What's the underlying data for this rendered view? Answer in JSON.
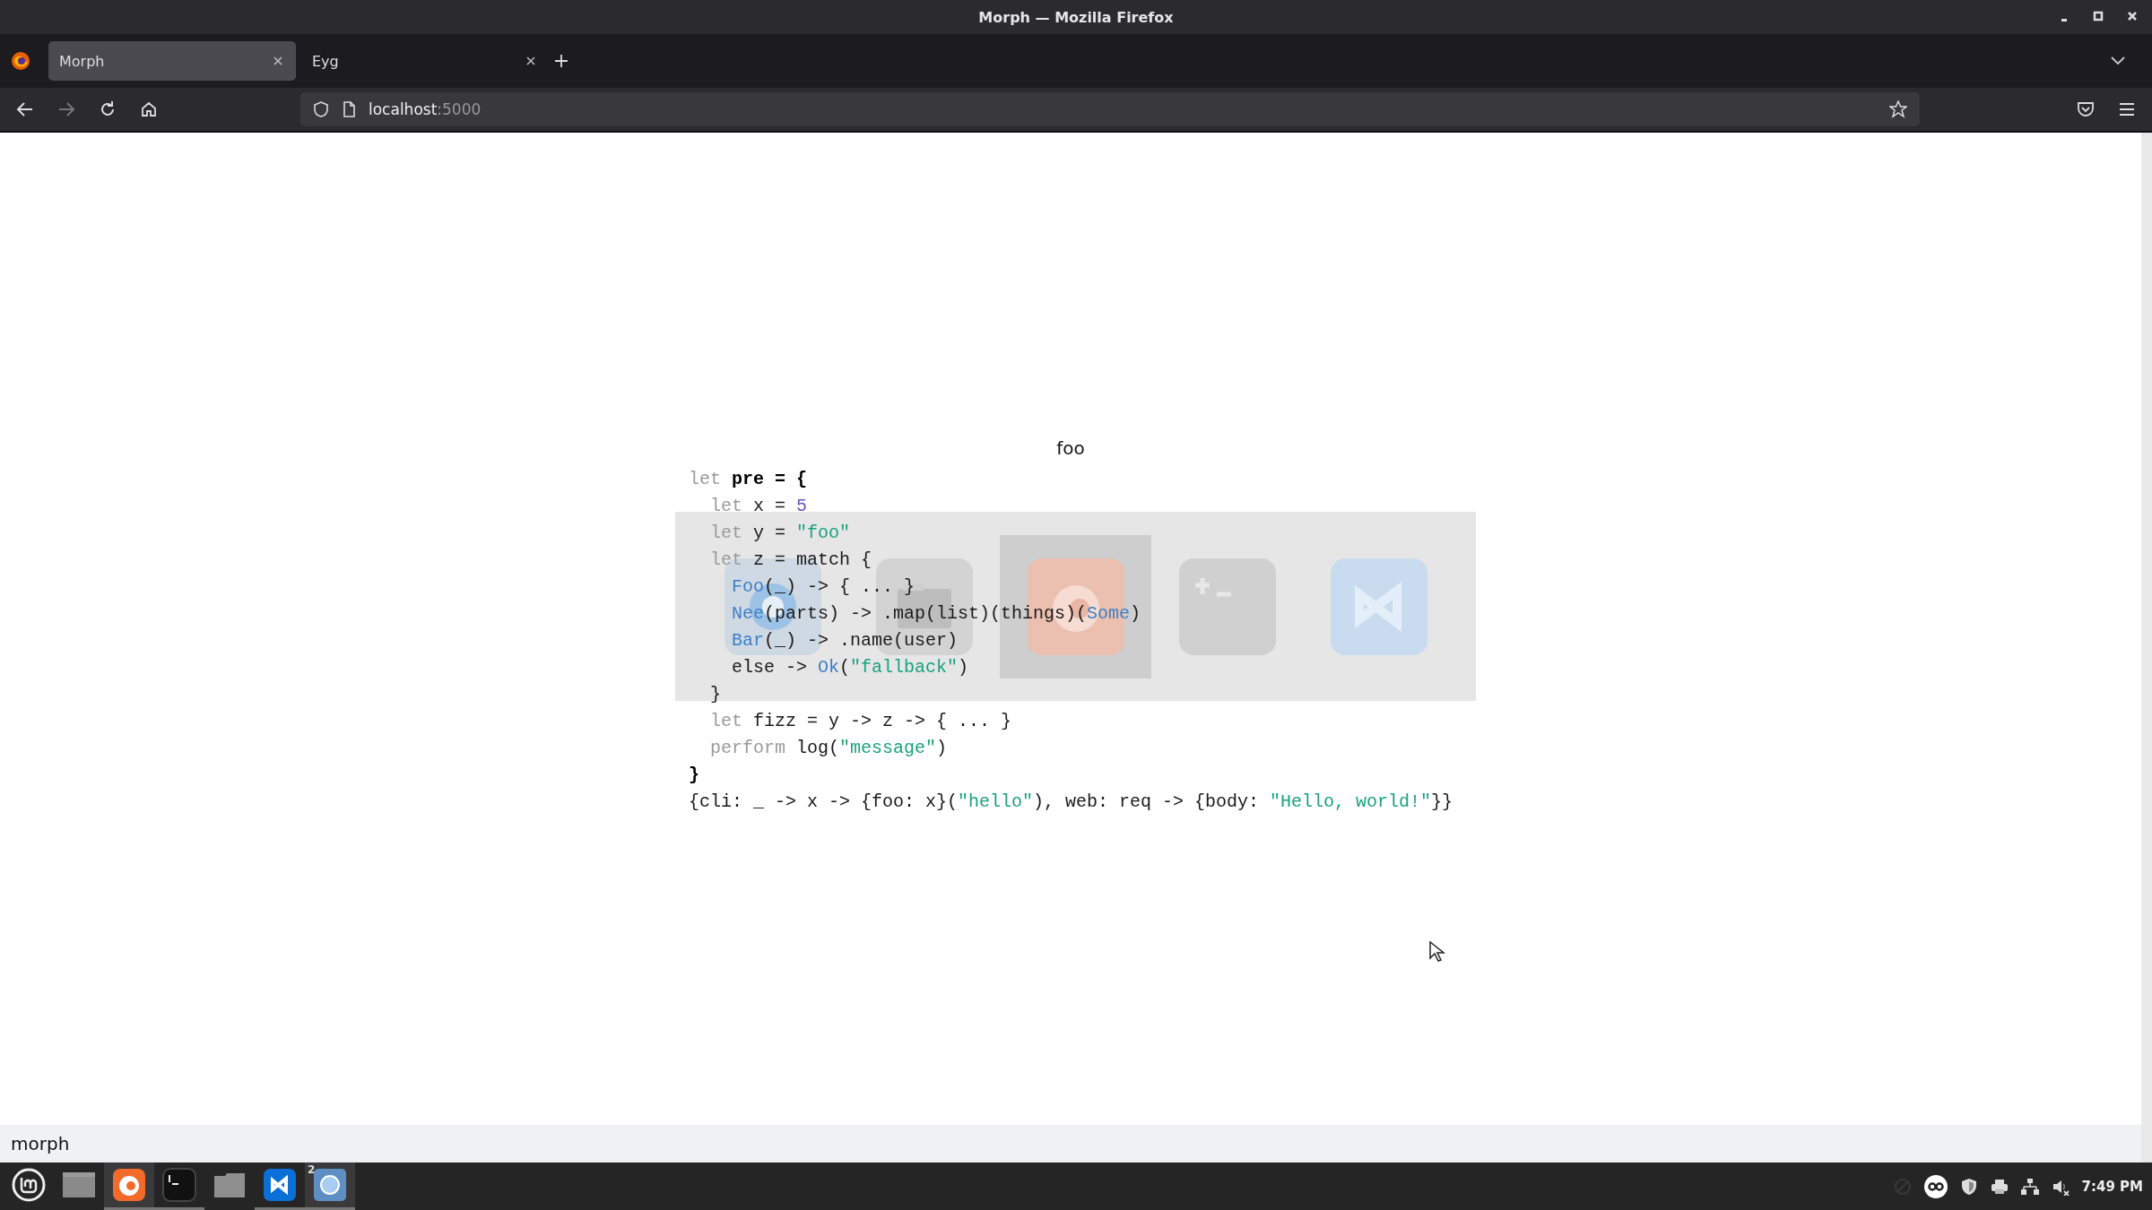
{
  "window": {
    "title": "Morph — Mozilla Firefox"
  },
  "tabs": [
    {
      "label": "Morph",
      "selected": true
    },
    {
      "label": "Eyg",
      "selected": false
    }
  ],
  "address_bar": {
    "host": "localhost",
    "port": ":5000"
  },
  "page": {
    "heading": "foo",
    "code_lines": [
      [
        {
          "text": "let",
          "kind": "keyword"
        },
        {
          "text": " pre = {",
          "kind": "bold"
        }
      ],
      [
        {
          "text": "  let",
          "kind": "keyword"
        },
        {
          "text": " x = "
        },
        {
          "text": "5",
          "kind": "number"
        }
      ],
      [
        {
          "text": "  let",
          "kind": "keyword"
        },
        {
          "text": " y = "
        },
        {
          "text": "\"foo\"",
          "kind": "string"
        }
      ],
      [
        {
          "text": "  let",
          "kind": "keyword"
        },
        {
          "text": " z = match {"
        }
      ],
      [
        {
          "text": "    Foo",
          "kind": "tag"
        },
        {
          "text": "(_) -> { ... }"
        }
      ],
      [
        {
          "text": "    Nee",
          "kind": "tag"
        },
        {
          "text": "(parts) -> .map(list)(things)("
        },
        {
          "text": "Some",
          "kind": "tag"
        },
        {
          "text": ")"
        }
      ],
      [
        {
          "text": "    Bar",
          "kind": "tag"
        },
        {
          "text": "(_) -> .name(user)"
        }
      ],
      [
        {
          "text": "    else -> "
        },
        {
          "text": "Ok",
          "kind": "tag"
        },
        {
          "text": "("
        },
        {
          "text": "\"fallback\"",
          "kind": "string"
        },
        {
          "text": ")"
        }
      ],
      [
        {
          "text": "  }"
        }
      ],
      [
        {
          "text": "  let",
          "kind": "keyword"
        },
        {
          "text": " fizz = y -> z -> { ... }"
        }
      ],
      [
        {
          "text": "  perform",
          "kind": "keyword"
        },
        {
          "text": " log("
        },
        {
          "text": "\"message\"",
          "kind": "string"
        },
        {
          "text": ")"
        }
      ],
      [
        {
          "text": "}",
          "kind": "bold"
        }
      ],
      [
        {
          "text": "{cli: _ -> x -> {foo: x}("
        },
        {
          "text": "\"hello\"",
          "kind": "string"
        },
        {
          "text": "), web: req -> {body: "
        },
        {
          "text": "\"Hello, world!\"",
          "kind": "string"
        },
        {
          "text": "}}"
        }
      ]
    ]
  },
  "app_switcher": {
    "tiles": [
      {
        "kind": "browser",
        "selected": false
      },
      {
        "kind": "files",
        "selected": false
      },
      {
        "kind": "firefox",
        "selected": true
      },
      {
        "kind": "terminal",
        "selected": false
      },
      {
        "kind": "vscode",
        "selected": false
      }
    ]
  },
  "status_bar": {
    "text": "morph"
  },
  "taskbar": {
    "items": [
      {
        "kind": "menu",
        "active": false,
        "running": false
      },
      {
        "kind": "desktop",
        "active": false,
        "running": false
      },
      {
        "kind": "firefox",
        "active": true,
        "running": true
      },
      {
        "kind": "terminal",
        "active": false,
        "running": true
      },
      {
        "kind": "files",
        "active": false,
        "running": false
      },
      {
        "kind": "vscode",
        "active": false,
        "running": true
      },
      {
        "kind": "browser",
        "active": true,
        "running": true,
        "badge": "2"
      }
    ],
    "clock": "7:49 PM"
  }
}
